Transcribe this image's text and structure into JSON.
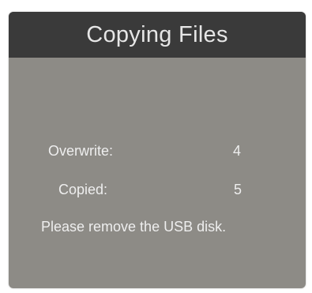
{
  "dialog": {
    "title": "Copying Files",
    "overwrite_label": "Overwrite:",
    "overwrite_value": "4",
    "copied_label": "Copied:",
    "copied_value": "5",
    "message": "Please remove the USB disk."
  },
  "colors": {
    "title_bar": "#3a3a3a",
    "body": "#8d8b86",
    "text": "#eeeeee"
  }
}
